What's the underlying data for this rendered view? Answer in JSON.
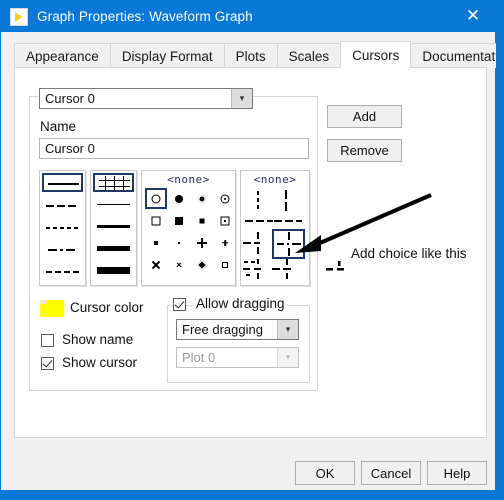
{
  "window": {
    "title": "Graph Properties: Waveform Graph",
    "icon": "labview-run-icon",
    "close_label": "✕"
  },
  "tabs": {
    "items": [
      {
        "label": "Appearance",
        "selected": false
      },
      {
        "label": "Display Format",
        "selected": false
      },
      {
        "label": "Plots",
        "selected": false
      },
      {
        "label": "Scales",
        "selected": false
      },
      {
        "label": "Cursors",
        "selected": true
      },
      {
        "label": "Documentation",
        "selected": false
      }
    ],
    "nav_prev": "◂",
    "nav_next": "▸"
  },
  "cursor_panel": {
    "cursor_select": {
      "value": "Cursor 0"
    },
    "name_label": "Name",
    "name_value": "Cursor 0",
    "palettes": {
      "line_style": {
        "header": "",
        "selected_index": 0,
        "options": [
          "solid",
          "dash-long",
          "dot",
          "dash-dot",
          "dash-short"
        ]
      },
      "line_width": {
        "header": "",
        "selected_index": 0,
        "options": [
          "crosshair",
          "1px",
          "2px",
          "3px",
          "4px",
          "5px"
        ]
      },
      "point_style": {
        "header": "<none>",
        "selected_index": 0,
        "options": [
          "circle-open",
          "circle-filled",
          "circle-dot",
          "circle-ring",
          "square-open",
          "square-filled",
          "square-dot",
          "square-ring",
          "square-small",
          "dot-tiny",
          "plus",
          "plus-small",
          "x-mark",
          "x-small",
          "diamond",
          "square-mini"
        ]
      },
      "cursor_style": {
        "header": "<none>",
        "selected_index": 4,
        "options": [
          "dot-v",
          "line-v",
          "dash-h",
          "dash-cross",
          "cross-full",
          "dot-cross"
        ]
      }
    },
    "cursor_color": {
      "label": "Cursor color",
      "color": "#ffff00"
    },
    "show_name": {
      "label": "Show name",
      "checked": false
    },
    "show_cursor": {
      "label": "Show cursor",
      "checked": true
    },
    "allow_dragging": {
      "label": "Allow dragging",
      "checked": true,
      "mode": {
        "value": "Free dragging",
        "enabled": true
      },
      "plot": {
        "value": "Plot 0",
        "enabled": false
      }
    }
  },
  "side_buttons": {
    "add": "Add",
    "remove": "Remove"
  },
  "annotation": {
    "text": "Add choice like this",
    "arrow": "arrow-pointing-left",
    "glyph": "dash-tick-dash"
  },
  "footer": {
    "ok": "OK",
    "cancel": "Cancel",
    "help": "Help"
  },
  "colors": {
    "accent": "#0a78d7",
    "dialog_bg": "#f0f0f0",
    "page_bg": "#ffffff",
    "selection_outline": "#1f3864",
    "swatch": "#ffff00"
  }
}
